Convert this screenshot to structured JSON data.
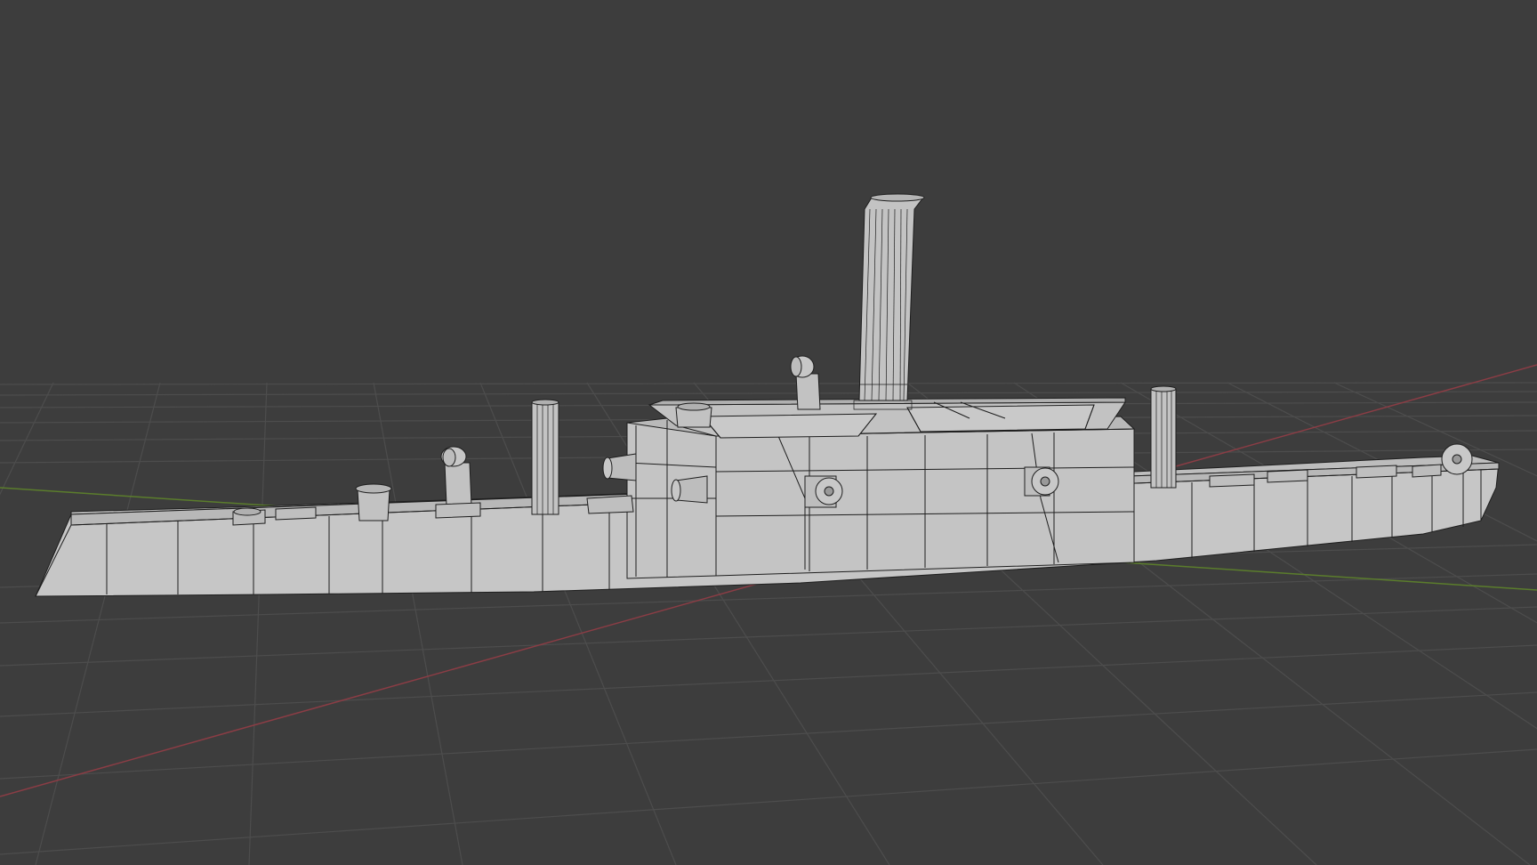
{
  "viewport": {
    "background_color": "#3d3d3d",
    "grid_color": "#4b4b4b",
    "x_axis_color": "#8a3d45",
    "y_axis_color": "#5b7d2c",
    "mesh_fill_color": "#c8c8c8",
    "mesh_shade_color": "#b4b4b4",
    "wire_color": "#1e1e1e"
  },
  "scene": {
    "object": "ship-mesh",
    "display_mode": "solid-with-wireframe"
  }
}
